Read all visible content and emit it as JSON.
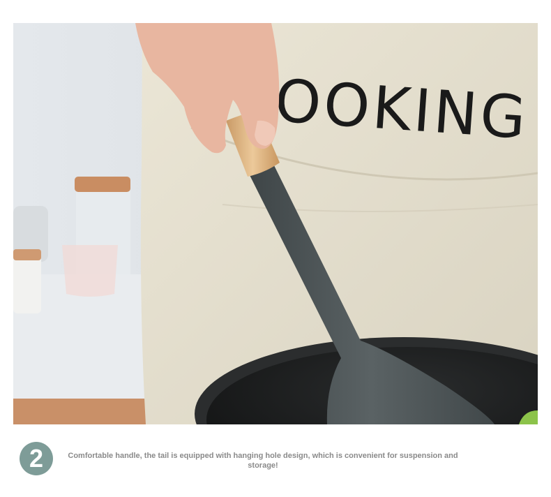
{
  "photo": {
    "apron_print": "OOKING",
    "colors": {
      "apron": "#e6e0cf",
      "wall": "#dfe4e8",
      "spatula": "#4b5254",
      "handle": "#deb686",
      "pan": "#151616"
    }
  },
  "step": {
    "number": "2",
    "badge_color": "#7e9c98",
    "description": "Comfortable handle, the tail is equipped with hanging hole design, which is convenient for suspension and storage!"
  }
}
